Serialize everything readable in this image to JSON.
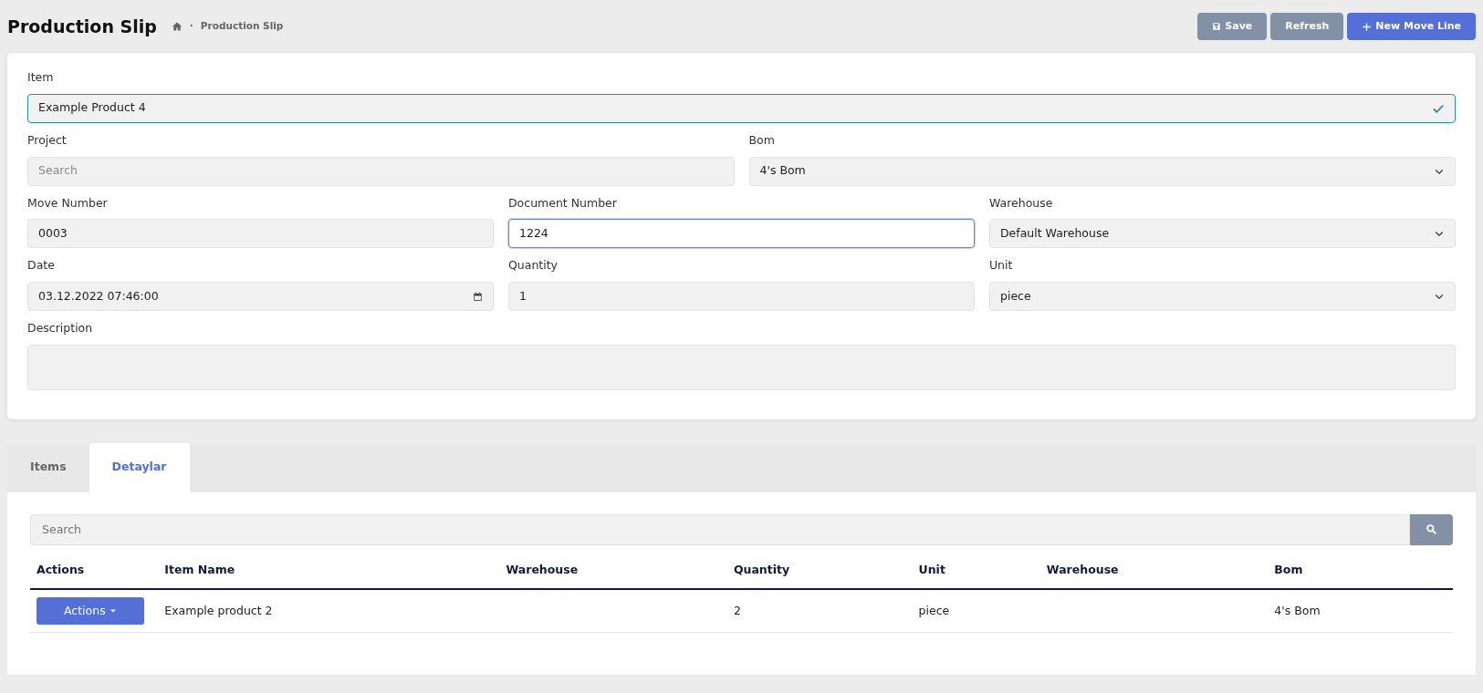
{
  "header": {
    "title": "Production Slip",
    "breadcrumb": {
      "separator": "·",
      "items": [
        "Production Slip"
      ]
    },
    "buttons": [
      {
        "label": "Save",
        "kind": "save"
      },
      {
        "label": "Refresh",
        "kind": "refresh"
      },
      {
        "label": "New Move Line",
        "kind": "add"
      }
    ]
  },
  "form": {
    "rows": [
      [
        {
          "label": "Item",
          "kind": "text",
          "value": "Example Product 4",
          "valid": true
        }
      ],
      [
        {
          "label": "Project",
          "kind": "text",
          "placeholder": "Search"
        },
        {
          "label": "Bom",
          "kind": "select",
          "value": "4's Bom"
        }
      ],
      [
        {
          "label": "Move Number",
          "kind": "text",
          "value": "0003"
        },
        {
          "label": "Document Number",
          "kind": "text",
          "value": "1224",
          "focused": true
        },
        {
          "label": "Warehouse",
          "kind": "select",
          "value": "Default Warehouse"
        }
      ],
      [
        {
          "label": "Date",
          "kind": "date",
          "value": "03.12.2022 07:46:00"
        },
        {
          "label": "Quantity",
          "kind": "text",
          "value": "1"
        },
        {
          "label": "Unit",
          "kind": "select",
          "value": "piece"
        }
      ],
      [
        {
          "label": "Description",
          "kind": "textarea"
        }
      ]
    ]
  },
  "tabs": [
    {
      "label": "Items",
      "selected": false
    },
    {
      "label": "Detaylar",
      "selected": true
    }
  ],
  "table": {
    "search": {
      "placeholder": "Search"
    },
    "columns": [
      "Actions",
      "Item Name",
      "Warehouse",
      "Quantity",
      "Unit",
      "Warehouse",
      "Bom"
    ],
    "rows": [
      {
        "cells": [
          "Actions",
          "Example product 2",
          "",
          "2",
          "piece",
          "",
          "4's Bom"
        ]
      }
    ]
  }
}
